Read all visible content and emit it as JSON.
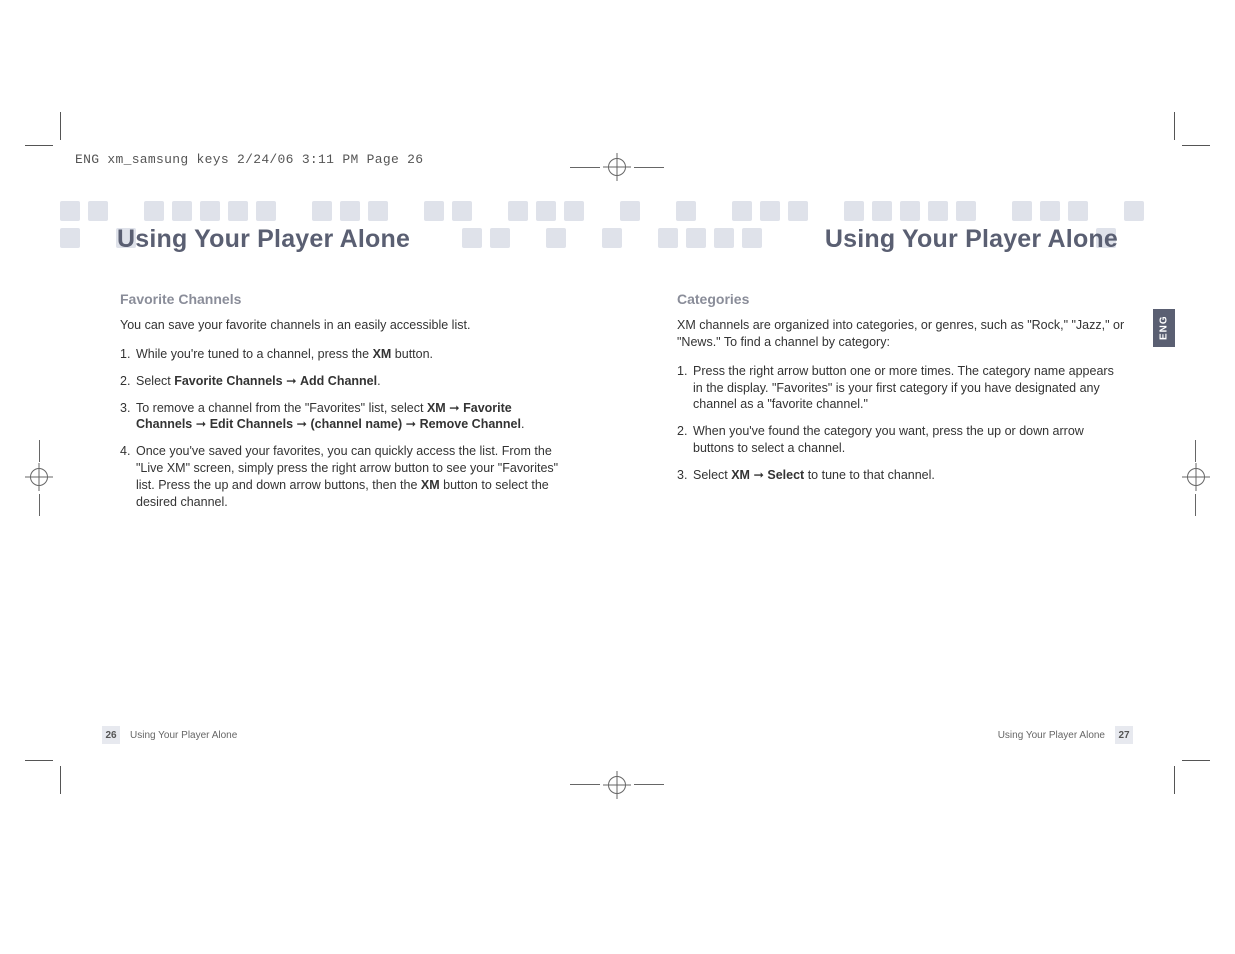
{
  "slug": "ENG xm_samsung keys  2/24/06  3:11 PM  Page 26",
  "header": {
    "left": "Using Your Player Alone",
    "right": "Using Your Player Alone"
  },
  "tab": "ENG",
  "left_page": {
    "section": "Favorite Channels",
    "intro": "You can save your favorite channels in an easily accessible list.",
    "items": [
      {
        "n": "1.",
        "pre": "While you're tuned to a channel, press the ",
        "b1": "XM",
        "post": " button."
      },
      {
        "n": "2.",
        "pre": "Select ",
        "b1": "Favorite Channels",
        "mid": " ➞ ",
        "b2": "Add Channel",
        "post": "."
      },
      {
        "n": "3.",
        "pre": "To remove a channel from the \"Favorites\" list, select ",
        "b1": "XM",
        "m1": " ➞ ",
        "b2": "Favorite Channels",
        "m2": " ➞ ",
        "b3": "Edit Channels",
        "m3": " ➞ ",
        "b4": "(channel name)",
        "m4": " ➞ ",
        "b5": "Remove Channel",
        "post": "."
      },
      {
        "n": "4.",
        "pre": "Once you've saved your favorites, you can quickly access the list. From the \"Live XM\" screen, simply press the right arrow button to see your \"Favorites\" list. Press the up and down arrow buttons, then the ",
        "b1": "XM",
        "post": " button to select the desired channel."
      }
    ],
    "footer_label": "Using Your Player Alone",
    "page_no": "26"
  },
  "right_page": {
    "section": "Categories",
    "intro": "XM channels are organized into categories, or genres, such as \"Rock,\" \"Jazz,\" or \"News.\" To find a channel by category:",
    "items": [
      {
        "n": "1.",
        "text": "Press the right arrow button one or more times. The category name appears in the display. \"Favorites\" is your first category if you have designated any channel as a \"favorite channel.\""
      },
      {
        "n": "2.",
        "text": "When you've found the category you want, press the up or down arrow buttons to select a channel."
      },
      {
        "n": "3.",
        "pre": "Select ",
        "b1": "XM",
        "m1": " ➞ ",
        "b2": "Select",
        "post": " to tune to that channel."
      }
    ],
    "footer_label": "Using Your Player Alone",
    "page_no": "27"
  }
}
